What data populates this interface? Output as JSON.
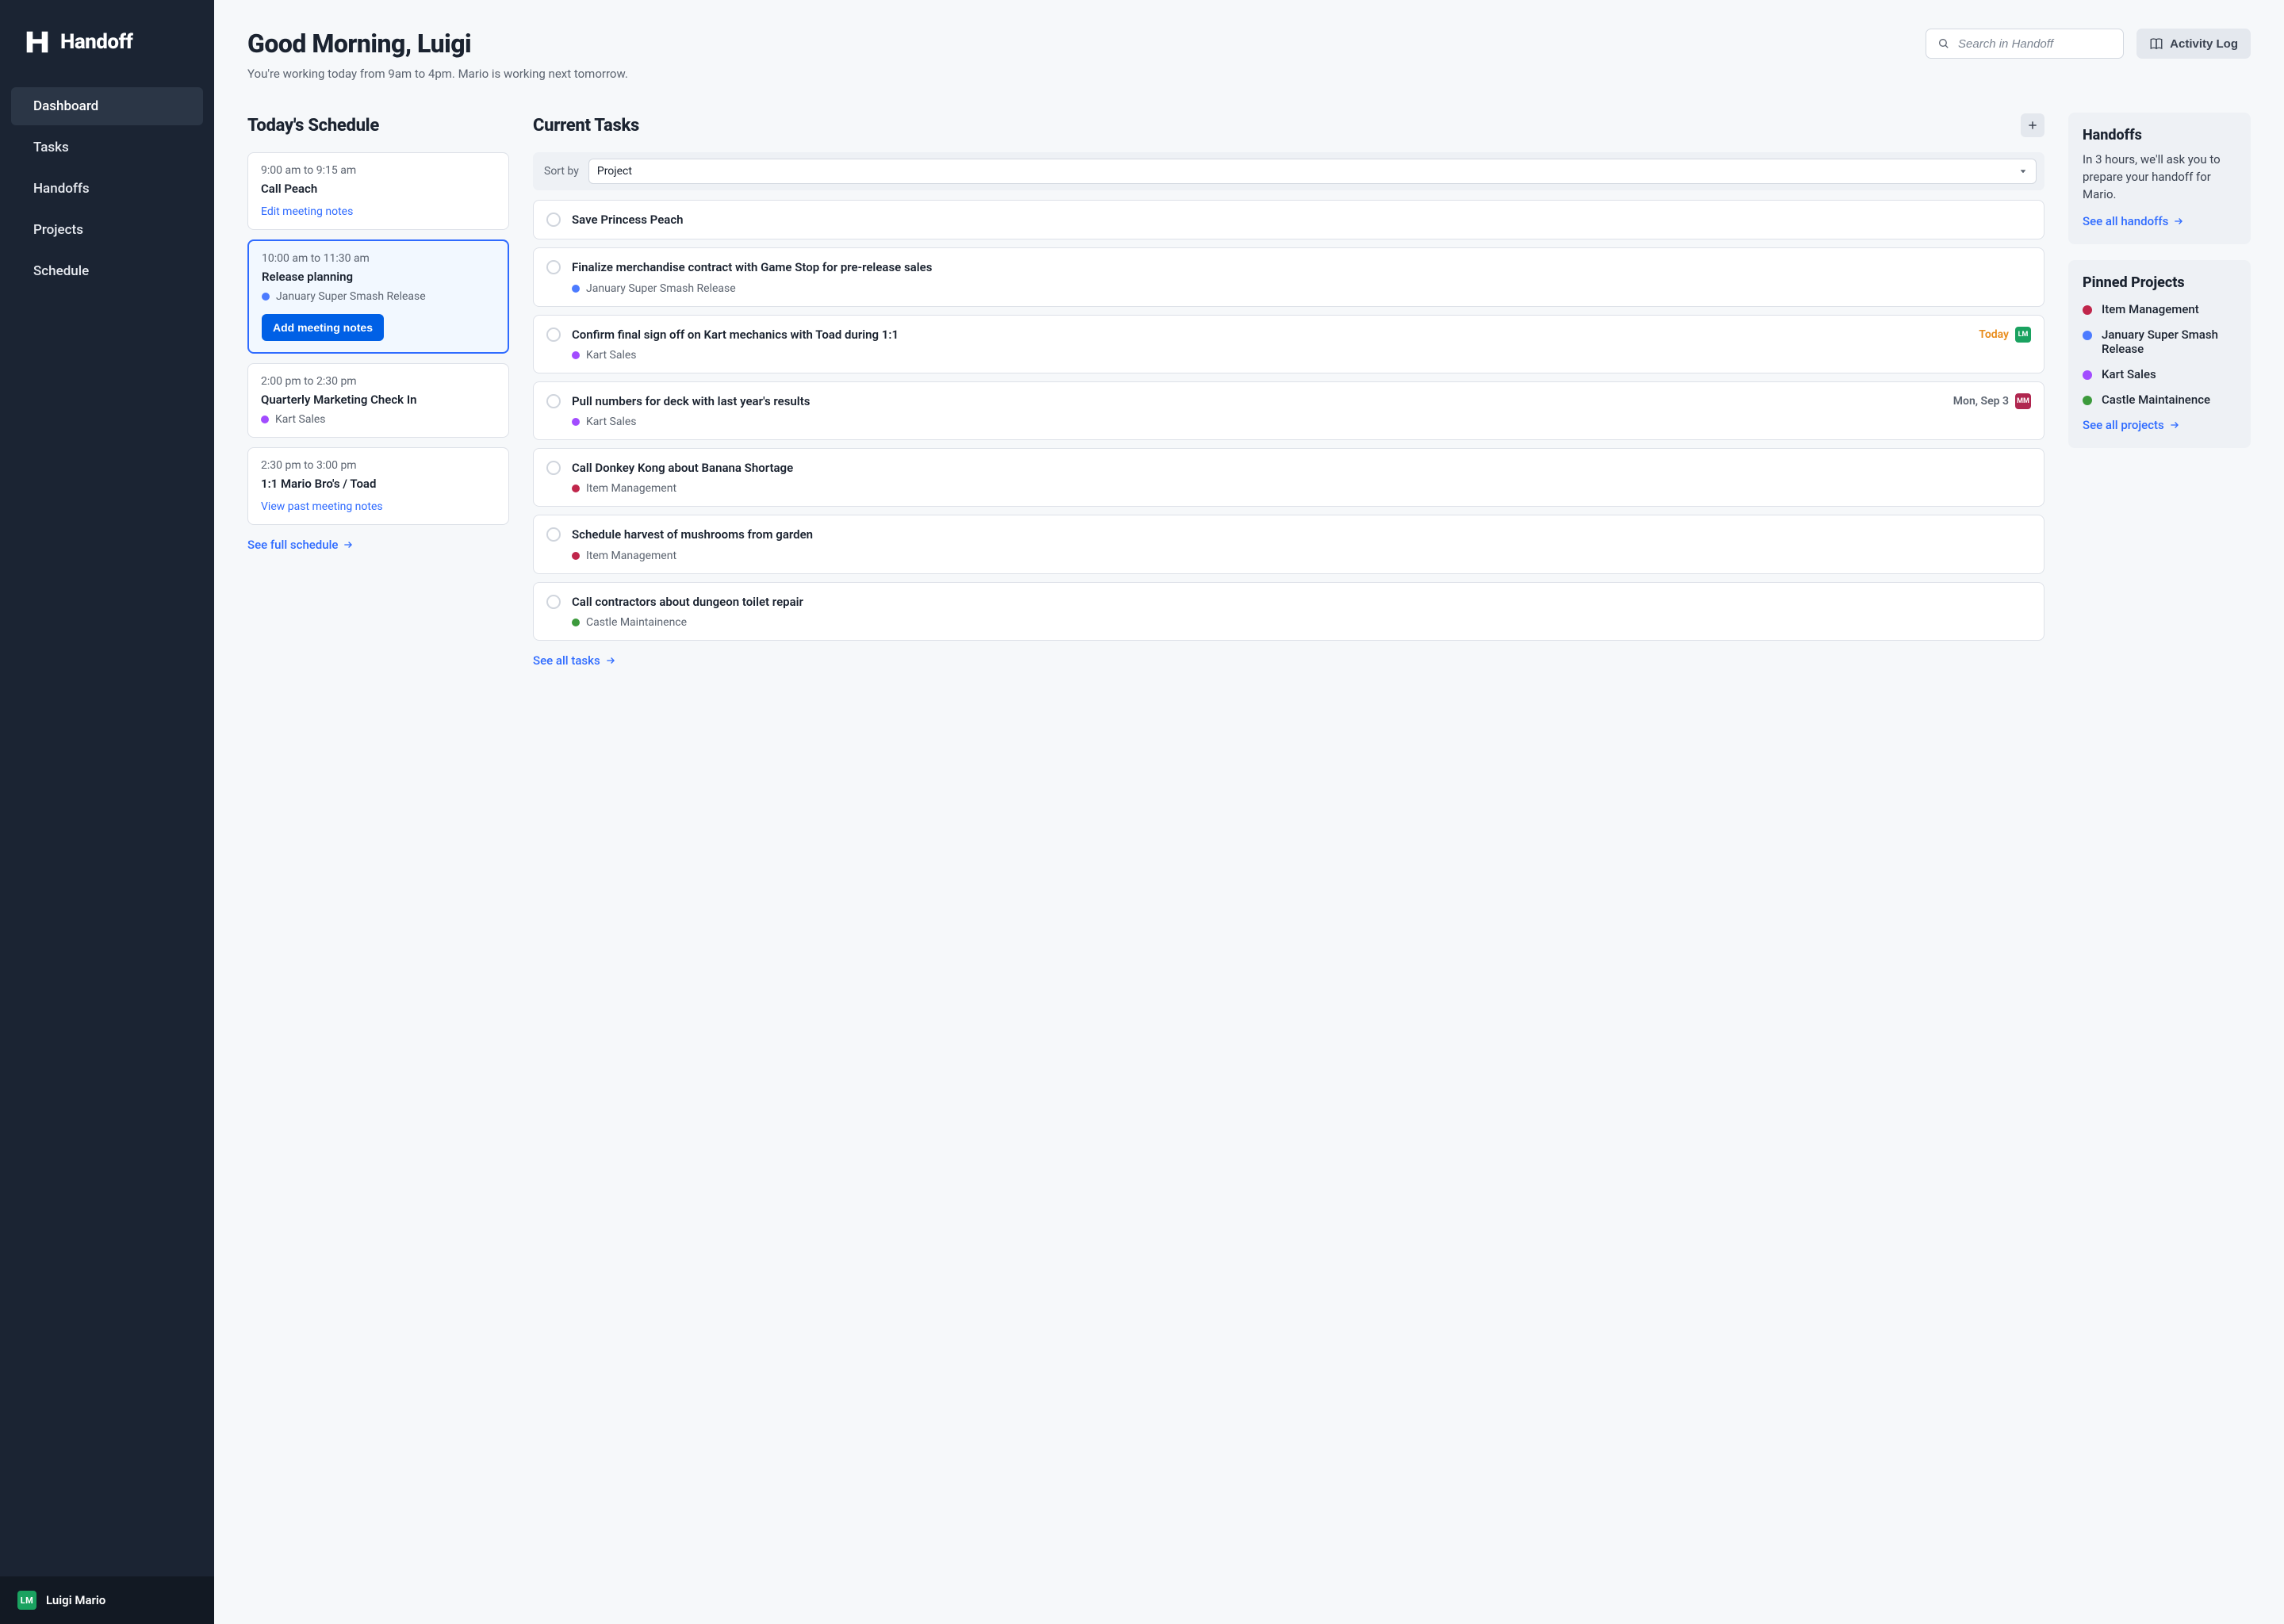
{
  "app": {
    "name": "Handoff"
  },
  "nav": {
    "items": [
      {
        "label": "Dashboard",
        "active": true
      },
      {
        "label": "Tasks",
        "active": false
      },
      {
        "label": "Handoffs",
        "active": false
      },
      {
        "label": "Projects",
        "active": false
      },
      {
        "label": "Schedule",
        "active": false
      }
    ]
  },
  "user": {
    "initials": "LM",
    "name": "Luigi Mario"
  },
  "header": {
    "greeting": "Good Morning, Luigi",
    "subtitle": "You're working today from 9am to 4pm. Mario is working next tomorrow.",
    "search_placeholder": "Search in Handoff",
    "activity_label": "Activity Log"
  },
  "schedule": {
    "title": "Today's Schedule",
    "see_all": "See full schedule",
    "events": [
      {
        "time": "9:00 am to 9:15 am",
        "title": "Call Peach",
        "link": "Edit meeting notes",
        "current": false
      },
      {
        "time": "10:00 am to 11:30 am",
        "title": "Release planning",
        "project": "January Super Smash Release",
        "project_color": "#4C7BFF",
        "button": "Add meeting notes",
        "current": true
      },
      {
        "time": "2:00 pm to 2:30 pm",
        "title": "Quarterly Marketing Check In",
        "project": "Kart Sales",
        "project_color": "#A24CFF",
        "current": false
      },
      {
        "time": "2:30 pm to 3:00 pm",
        "title": "1:1 Mario Bro's / Toad",
        "link": "View past meeting notes",
        "current": false
      }
    ]
  },
  "tasks": {
    "title": "Current Tasks",
    "sort_label": "Sort by",
    "sort_value": "Project",
    "see_all": "See all tasks",
    "items": [
      {
        "title": "Save Princess Peach"
      },
      {
        "title": "Finalize merchandise contract with Game Stop for pre-release sales",
        "project": "January Super Smash Release",
        "project_color": "#4C7BFF"
      },
      {
        "title": "Confirm final sign off on Kart mechanics with Toad during 1:1",
        "project": "Kart Sales",
        "project_color": "#A24CFF",
        "due": "Today",
        "due_kind": "today",
        "avatar": "LM",
        "avatar_color": "green"
      },
      {
        "title": "Pull numbers for deck with last year's results",
        "project": "Kart Sales",
        "project_color": "#A24CFF",
        "due": "Mon, Sep 3",
        "due_kind": "date",
        "avatar": "MM",
        "avatar_color": "red"
      },
      {
        "title": "Call Donkey Kong about Banana Shortage",
        "project": "Item Management",
        "project_color": "#C0264B"
      },
      {
        "title": "Schedule harvest of mushrooms from garden",
        "project": "Item Management",
        "project_color": "#C0264B"
      },
      {
        "title": "Call contractors about dungeon toilet repair",
        "project": "Castle Maintainence",
        "project_color": "#3C9A3C"
      }
    ]
  },
  "handoffs_panel": {
    "title": "Handoffs",
    "text": "In 3 hours, we'll ask you to prepare your handoff for Mario.",
    "link": "See all handoffs"
  },
  "pinned_projects": {
    "title": "Pinned Projects",
    "link": "See all projects",
    "items": [
      {
        "label": "Item Management",
        "color": "#C0264B"
      },
      {
        "label": "January Super Smash Release",
        "color": "#4C7BFF"
      },
      {
        "label": "Kart Sales",
        "color": "#A24CFF"
      },
      {
        "label": "Castle Maintainence",
        "color": "#3C9A3C"
      }
    ]
  }
}
